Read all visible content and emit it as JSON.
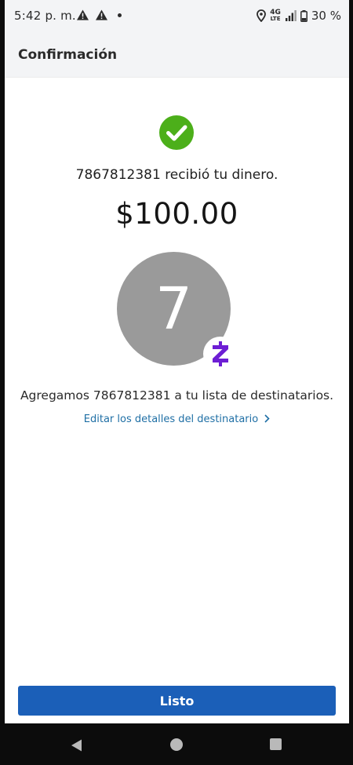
{
  "status_bar": {
    "time": "5:42 p. m.",
    "network": "4G",
    "network_sub": "LTE",
    "battery": "30 %",
    "icons": [
      "warning-icon",
      "warning-icon",
      "notification-dot",
      "location-icon",
      "signal-icon",
      "battery-icon"
    ]
  },
  "header": {
    "title": "Confirmación"
  },
  "confirmation": {
    "success_icon": "check-circle-icon",
    "success_color": "#4caf1a",
    "received_text": "7867812381 recibió tu dinero.",
    "amount": "$100.00",
    "avatar_initial": "7",
    "avatar_color": "#9a9a9a",
    "badge_icon": "zelle-icon",
    "badge_color": "#6d1ed4",
    "added_text": "Agregamos 7867812381 a tu lista de destinatarios.",
    "edit_link": "Editar los detalles del destinatario",
    "link_color": "#1f6fa5"
  },
  "footer": {
    "done_button": "Listo",
    "button_color": "#1b5fb8"
  },
  "nav_bar": {
    "icons": [
      "back-icon",
      "home-icon",
      "recents-icon"
    ]
  }
}
